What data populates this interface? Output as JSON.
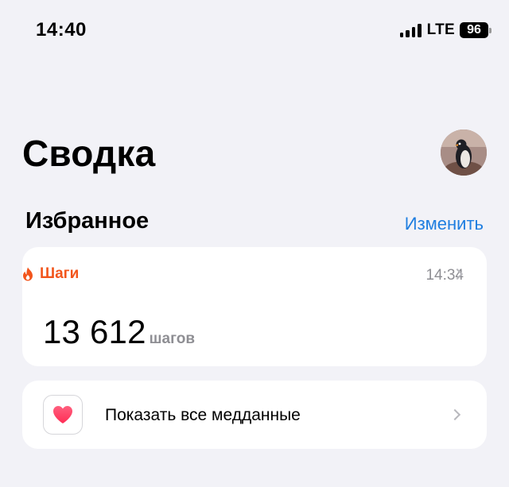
{
  "status_bar": {
    "time": "14:40",
    "network": "LTE",
    "battery": "96"
  },
  "header": {
    "title": "Сводка",
    "avatar_icon": "penguin-avatar"
  },
  "favorites": {
    "title": "Избранное",
    "edit_label": "Изменить",
    "card": {
      "icon": "flame-icon",
      "label": "Шаги",
      "time": "14:34",
      "value": "13 612",
      "unit": "шагов"
    }
  },
  "show_all": {
    "icon": "health-heart-icon",
    "label": "Показать все медданные"
  },
  "colors": {
    "background": "#f2f2f7",
    "accent_blue": "#1f7ee0",
    "steps_orange": "#f2551c",
    "heart_pink": "#ff2d55",
    "secondary_gray": "#8e8e93"
  }
}
